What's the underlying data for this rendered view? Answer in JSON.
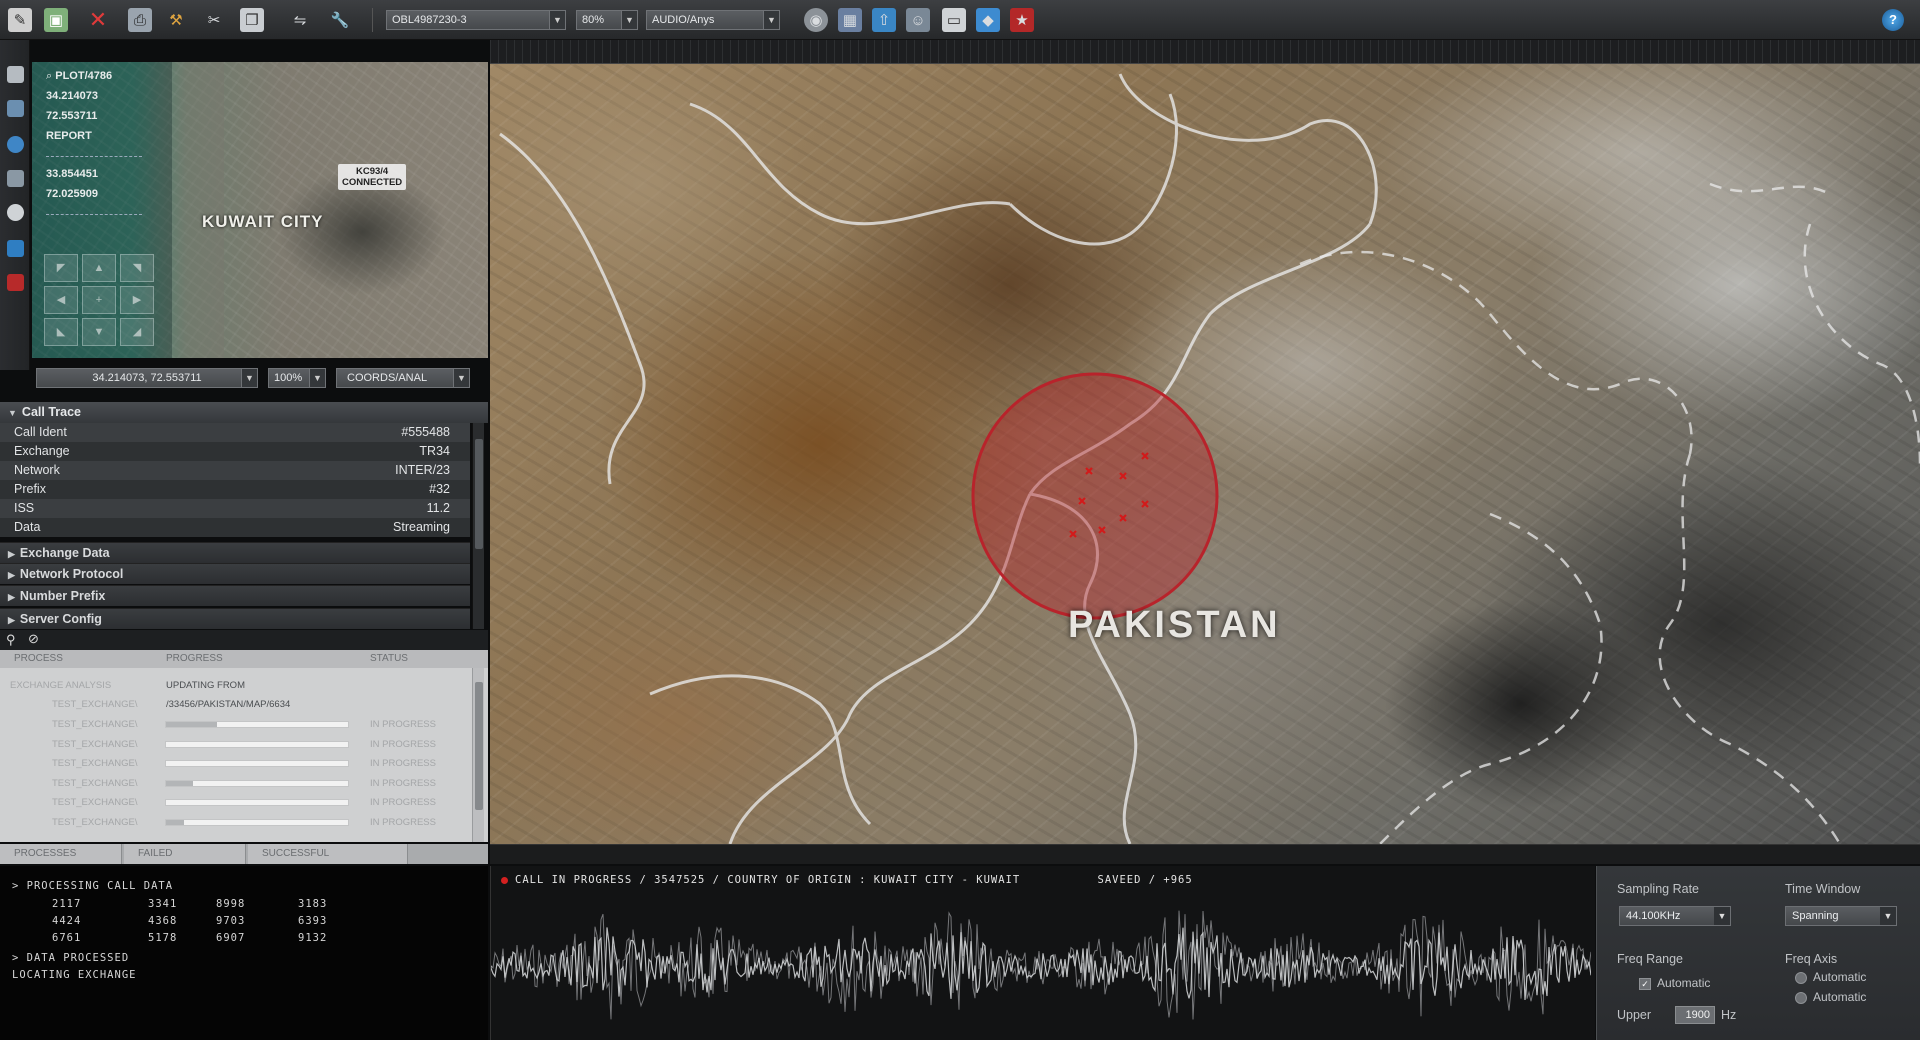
{
  "toolbar": {
    "file_select": "OBL4987230-3",
    "zoom_select": "80%",
    "audio_select": "AUDIO/Anys",
    "help": "?"
  },
  "mini_map": {
    "plot_label": "PLOT/4786",
    "coord1_lat": "34.214073",
    "coord1_lon": "72.553711",
    "report_label": "REPORT",
    "coord2_lat": "33.854451",
    "coord2_lon": "72.025909",
    "city_label": "KUWAIT CITY",
    "connected_line1": "KC93/4",
    "connected_line2": "CONNECTED",
    "coords_select": "34.214073, 72.553711",
    "zoom_select": "100%",
    "mode_select": "COORDS/ANAL"
  },
  "call_trace": {
    "title": "Call Trace",
    "rows": [
      {
        "key": "Call Ident",
        "value": "#555488"
      },
      {
        "key": "Exchange",
        "value": "TR34"
      },
      {
        "key": "Network",
        "value": "INTER/23"
      },
      {
        "key": "Prefix",
        "value": "#32"
      },
      {
        "key": "ISS",
        "value": "11.2"
      },
      {
        "key": "Data",
        "value": "Streaming"
      }
    ],
    "sections": [
      "Exchange Data",
      "Network Protocol",
      "Number Prefix",
      "Server Config"
    ]
  },
  "process_table": {
    "headers": [
      "PROCESS",
      "PROGRESS",
      "STATUS"
    ],
    "first_row": {
      "process": "EXCHANGE ANALYSIS",
      "progress": "UPDATING FROM"
    },
    "path_row": "/33456/PAKISTAN/MAP/6634",
    "path_prefix": "TEST_EXCHANGE\\",
    "rows": [
      {
        "process": "TEST_EXCHANGE\\",
        "progress": 0.28,
        "status": "IN PROGRESS"
      },
      {
        "process": "TEST_EXCHANGE\\",
        "progress": 0.0,
        "status": "IN PROGRESS"
      },
      {
        "process": "TEST_EXCHANGE\\",
        "progress": 0.0,
        "status": "IN PROGRESS"
      },
      {
        "process": "TEST_EXCHANGE\\",
        "progress": 0.15,
        "status": "IN PROGRESS"
      },
      {
        "process": "TEST_EXCHANGE\\",
        "progress": 0.0,
        "status": "IN PROGRESS"
      },
      {
        "process": "TEST_EXCHANGE\\",
        "progress": 0.1,
        "status": "IN PROGRESS"
      }
    ],
    "tabs": [
      "PROCESSES",
      "FAILED",
      "SUCCESSFUL"
    ]
  },
  "console": {
    "line1": "> PROCESSING CALL DATA",
    "numbers": [
      [
        "2117",
        "3341",
        "8998",
        "3183"
      ],
      [
        "4424",
        "4368",
        "9703",
        "6393"
      ],
      [
        "6761",
        "5178",
        "6907",
        "9132"
      ]
    ],
    "line2": "> DATA PROCESSED",
    "line3": "LOCATING EXCHANGE"
  },
  "main_map": {
    "country_label": "PAKISTAN"
  },
  "waveform": {
    "status": "CALL IN PROGRESS / 3547525 / COUNTRY OF ORIGIN : KUWAIT CITY - KUWAIT",
    "saved": "SAVEED / +965"
  },
  "controls": {
    "sampling_rate_label": "Sampling Rate",
    "sampling_rate_value": "44.100KHz",
    "time_window_label": "Time Window",
    "time_window_value": "Spanning",
    "freq_range_label": "Freq Range",
    "freq_range_auto": "Automatic",
    "freq_axis_label": "Freq Axis",
    "freq_axis_opt1": "Automatic",
    "freq_axis_opt2": "Automatic",
    "upper_label": "Upper",
    "upper_value": "1900",
    "upper_unit": "Hz"
  },
  "colors": {
    "target_circle": "#b8232b",
    "marker": "#d21a1a"
  },
  "icons": [
    "edit-icon",
    "save-icon",
    "delete-icon",
    "print-icon",
    "tools-icon",
    "cut-icon",
    "copy-icon",
    "link-icon",
    "wrench-icon",
    "help-icon",
    "search-icon"
  ]
}
